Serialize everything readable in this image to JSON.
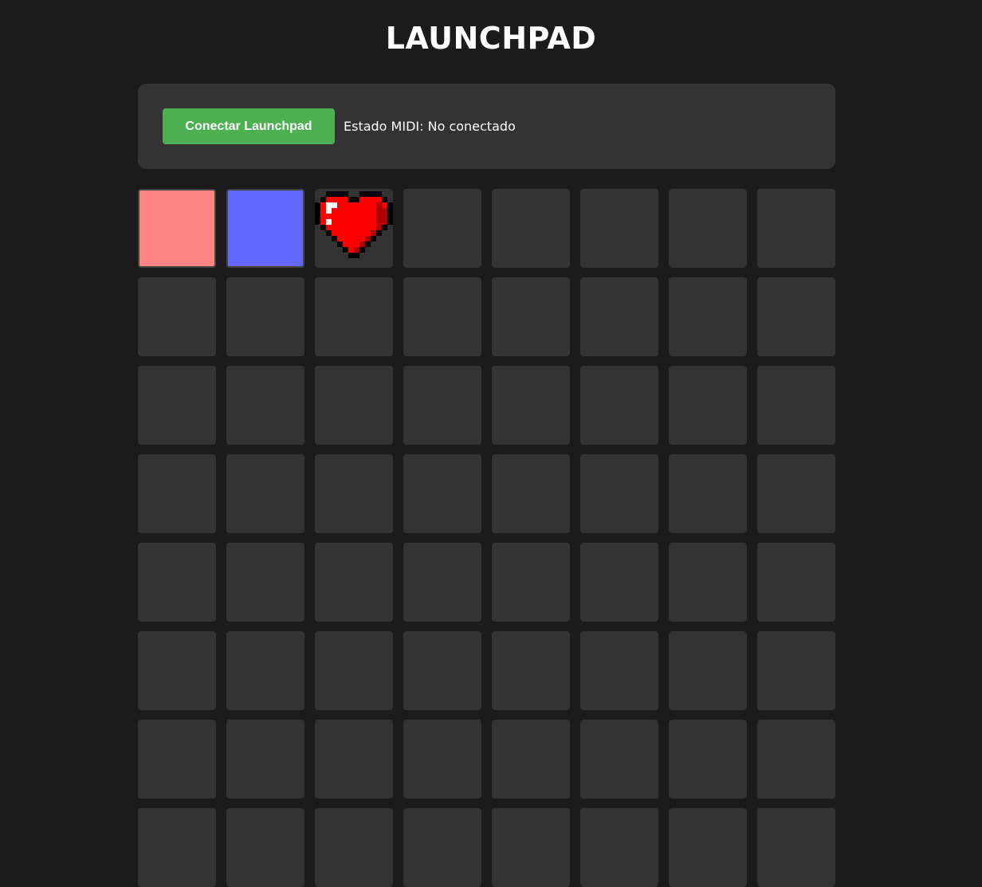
{
  "header": {
    "title": "LAUNCHPAD"
  },
  "controls": {
    "connect_label": "Conectar Launchpad",
    "status_text": "Estado MIDI: No conectado"
  },
  "colors": {
    "background": "#1b1b1b",
    "panel": "#333333",
    "connect_button": "#4caf50",
    "pad_off": "#333333"
  },
  "grid": {
    "columns": 8,
    "pads": [
      {
        "color": "#ff8585"
      },
      {
        "color": "#6366ff"
      },
      {
        "icon": "pixel-heart-icon"
      },
      {},
      {},
      {},
      {},
      {},
      {},
      {},
      {},
      {},
      {},
      {},
      {},
      {},
      {},
      {},
      {},
      {},
      {},
      {},
      {},
      {},
      {},
      {},
      {},
      {},
      {},
      {},
      {},
      {},
      {},
      {},
      {},
      {},
      {},
      {},
      {},
      {},
      {},
      {},
      {},
      {},
      {},
      {},
      {},
      {},
      {},
      {},
      {},
      {},
      {},
      {},
      {},
      {},
      {},
      {},
      {},
      {},
      {},
      {},
      {},
      {}
    ]
  }
}
